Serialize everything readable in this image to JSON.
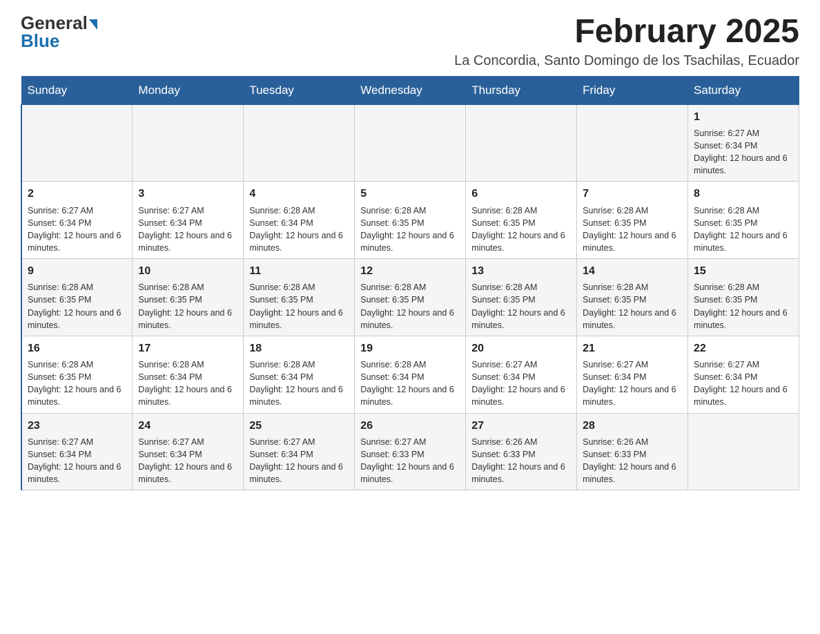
{
  "header": {
    "logo_general": "General",
    "logo_blue": "Blue",
    "title": "February 2025",
    "subtitle": "La Concordia, Santo Domingo de los Tsachilas, Ecuador"
  },
  "weekdays": [
    "Sunday",
    "Monday",
    "Tuesday",
    "Wednesday",
    "Thursday",
    "Friday",
    "Saturday"
  ],
  "weeks": [
    [
      {
        "day": "",
        "info": ""
      },
      {
        "day": "",
        "info": ""
      },
      {
        "day": "",
        "info": ""
      },
      {
        "day": "",
        "info": ""
      },
      {
        "day": "",
        "info": ""
      },
      {
        "day": "",
        "info": ""
      },
      {
        "day": "1",
        "info": "Sunrise: 6:27 AM\nSunset: 6:34 PM\nDaylight: 12 hours and 6 minutes."
      }
    ],
    [
      {
        "day": "2",
        "info": "Sunrise: 6:27 AM\nSunset: 6:34 PM\nDaylight: 12 hours and 6 minutes."
      },
      {
        "day": "3",
        "info": "Sunrise: 6:27 AM\nSunset: 6:34 PM\nDaylight: 12 hours and 6 minutes."
      },
      {
        "day": "4",
        "info": "Sunrise: 6:28 AM\nSunset: 6:34 PM\nDaylight: 12 hours and 6 minutes."
      },
      {
        "day": "5",
        "info": "Sunrise: 6:28 AM\nSunset: 6:35 PM\nDaylight: 12 hours and 6 minutes."
      },
      {
        "day": "6",
        "info": "Sunrise: 6:28 AM\nSunset: 6:35 PM\nDaylight: 12 hours and 6 minutes."
      },
      {
        "day": "7",
        "info": "Sunrise: 6:28 AM\nSunset: 6:35 PM\nDaylight: 12 hours and 6 minutes."
      },
      {
        "day": "8",
        "info": "Sunrise: 6:28 AM\nSunset: 6:35 PM\nDaylight: 12 hours and 6 minutes."
      }
    ],
    [
      {
        "day": "9",
        "info": "Sunrise: 6:28 AM\nSunset: 6:35 PM\nDaylight: 12 hours and 6 minutes."
      },
      {
        "day": "10",
        "info": "Sunrise: 6:28 AM\nSunset: 6:35 PM\nDaylight: 12 hours and 6 minutes."
      },
      {
        "day": "11",
        "info": "Sunrise: 6:28 AM\nSunset: 6:35 PM\nDaylight: 12 hours and 6 minutes."
      },
      {
        "day": "12",
        "info": "Sunrise: 6:28 AM\nSunset: 6:35 PM\nDaylight: 12 hours and 6 minutes."
      },
      {
        "day": "13",
        "info": "Sunrise: 6:28 AM\nSunset: 6:35 PM\nDaylight: 12 hours and 6 minutes."
      },
      {
        "day": "14",
        "info": "Sunrise: 6:28 AM\nSunset: 6:35 PM\nDaylight: 12 hours and 6 minutes."
      },
      {
        "day": "15",
        "info": "Sunrise: 6:28 AM\nSunset: 6:35 PM\nDaylight: 12 hours and 6 minutes."
      }
    ],
    [
      {
        "day": "16",
        "info": "Sunrise: 6:28 AM\nSunset: 6:35 PM\nDaylight: 12 hours and 6 minutes."
      },
      {
        "day": "17",
        "info": "Sunrise: 6:28 AM\nSunset: 6:34 PM\nDaylight: 12 hours and 6 minutes."
      },
      {
        "day": "18",
        "info": "Sunrise: 6:28 AM\nSunset: 6:34 PM\nDaylight: 12 hours and 6 minutes."
      },
      {
        "day": "19",
        "info": "Sunrise: 6:28 AM\nSunset: 6:34 PM\nDaylight: 12 hours and 6 minutes."
      },
      {
        "day": "20",
        "info": "Sunrise: 6:27 AM\nSunset: 6:34 PM\nDaylight: 12 hours and 6 minutes."
      },
      {
        "day": "21",
        "info": "Sunrise: 6:27 AM\nSunset: 6:34 PM\nDaylight: 12 hours and 6 minutes."
      },
      {
        "day": "22",
        "info": "Sunrise: 6:27 AM\nSunset: 6:34 PM\nDaylight: 12 hours and 6 minutes."
      }
    ],
    [
      {
        "day": "23",
        "info": "Sunrise: 6:27 AM\nSunset: 6:34 PM\nDaylight: 12 hours and 6 minutes."
      },
      {
        "day": "24",
        "info": "Sunrise: 6:27 AM\nSunset: 6:34 PM\nDaylight: 12 hours and 6 minutes."
      },
      {
        "day": "25",
        "info": "Sunrise: 6:27 AM\nSunset: 6:34 PM\nDaylight: 12 hours and 6 minutes."
      },
      {
        "day": "26",
        "info": "Sunrise: 6:27 AM\nSunset: 6:33 PM\nDaylight: 12 hours and 6 minutes."
      },
      {
        "day": "27",
        "info": "Sunrise: 6:26 AM\nSunset: 6:33 PM\nDaylight: 12 hours and 6 minutes."
      },
      {
        "day": "28",
        "info": "Sunrise: 6:26 AM\nSunset: 6:33 PM\nDaylight: 12 hours and 6 minutes."
      },
      {
        "day": "",
        "info": ""
      }
    ]
  ]
}
